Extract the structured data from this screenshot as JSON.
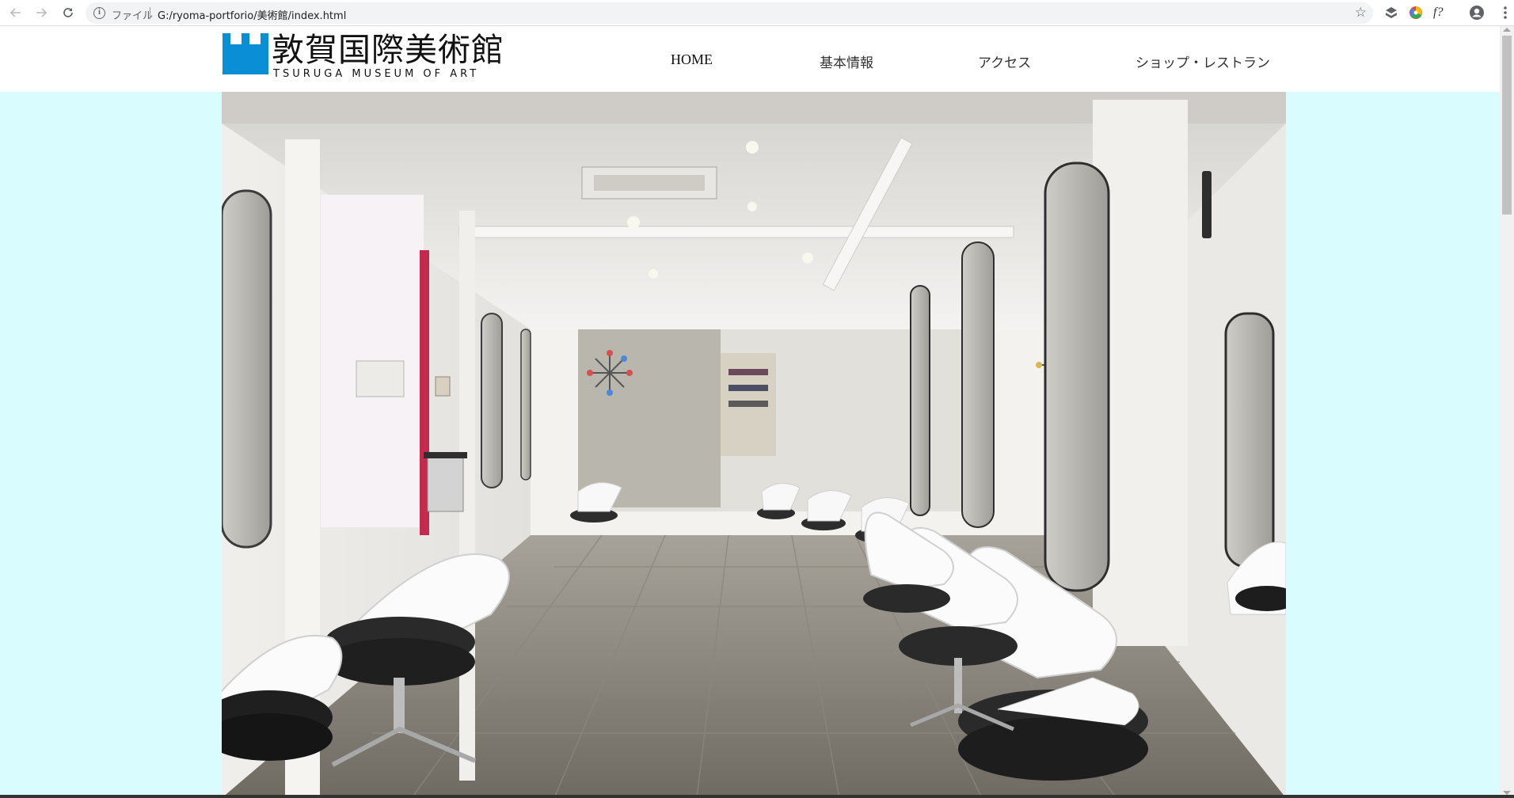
{
  "browser": {
    "back_icon": "arrow-left-icon",
    "forward_icon": "arrow-right-icon",
    "reload_icon": "reload-icon",
    "scheme_label": "ファイル",
    "url": "G:/ryoma-portforio/美術館/index.html",
    "bookmark_icon": "star-icon",
    "extensions": [
      "layers-extension-icon",
      "color-wheel-extension-icon",
      "font-extension-icon"
    ],
    "font_ext_label": "f?",
    "profile_icon": "account-circle-icon",
    "menu_icon": "kebab-menu-icon"
  },
  "site": {
    "logo": {
      "title_jp": "敦賀国際美術館",
      "title_en": "TSURUGA MUSEUM OF ART",
      "mark_color": "#0a8fd6"
    },
    "nav": [
      {
        "label": "HOME"
      },
      {
        "label": "基本情報"
      },
      {
        "label": "アクセス"
      },
      {
        "label": "ショップ・レストラン"
      }
    ],
    "colors": {
      "page_background": "#d9fcfe",
      "header_background": "#ffffff"
    },
    "hero": {
      "subject": "hair-salon-interior-photo"
    }
  }
}
